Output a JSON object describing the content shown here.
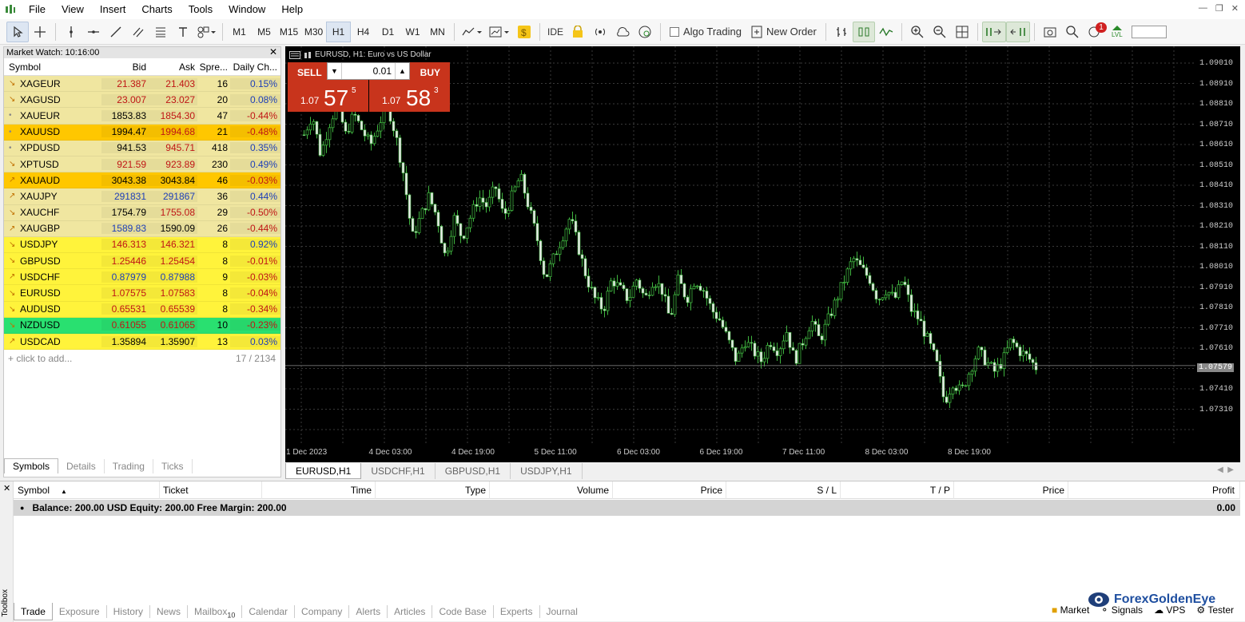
{
  "menu": [
    "File",
    "View",
    "Insert",
    "Charts",
    "Tools",
    "Window",
    "Help"
  ],
  "toolbar": {
    "timeframes": [
      "M1",
      "M5",
      "M15",
      "M30",
      "H1",
      "H4",
      "D1",
      "W1",
      "MN"
    ],
    "active_tf": "H1",
    "ide_label": "IDE",
    "algo_label": "Algo Trading",
    "new_order_label": "New Order",
    "notifications": "1",
    "lvl_label": "LVL"
  },
  "market_watch": {
    "title": "Market Watch: 10:16:00",
    "columns": [
      "Symbol",
      "Bid",
      "Ask",
      "Spre...",
      "Daily Ch..."
    ],
    "rows": [
      {
        "symbol": "XAGEUR",
        "bid": "21.387",
        "ask": "21.403",
        "spread": "16",
        "change": "0.15%",
        "arrow": "down",
        "color": "khaki",
        "bidc": "red",
        "askc": "red",
        "chgc": "blue"
      },
      {
        "symbol": "XAGUSD",
        "bid": "23.007",
        "ask": "23.027",
        "spread": "20",
        "change": "0.08%",
        "arrow": "down",
        "color": "khaki",
        "bidc": "red",
        "askc": "red",
        "chgc": "blue"
      },
      {
        "symbol": "XAUEUR",
        "bid": "1853.83",
        "ask": "1854.30",
        "spread": "47",
        "change": "-0.44%",
        "arrow": "dot",
        "color": "khaki",
        "bidc": "black",
        "askc": "red",
        "chgc": "red"
      },
      {
        "symbol": "XAUUSD",
        "bid": "1994.47",
        "ask": "1994.68",
        "spread": "21",
        "change": "-0.48%",
        "arrow": "dot",
        "color": "orange",
        "bidc": "black",
        "askc": "red",
        "chgc": "red"
      },
      {
        "symbol": "XPDUSD",
        "bid": "941.53",
        "ask": "945.71",
        "spread": "418",
        "change": "0.35%",
        "arrow": "dot",
        "color": "khaki",
        "bidc": "black",
        "askc": "red",
        "chgc": "blue"
      },
      {
        "symbol": "XPTUSD",
        "bid": "921.59",
        "ask": "923.89",
        "spread": "230",
        "change": "0.49%",
        "arrow": "down",
        "color": "khaki",
        "bidc": "red",
        "askc": "red",
        "chgc": "blue"
      },
      {
        "symbol": "XAUAUD",
        "bid": "3043.38",
        "ask": "3043.84",
        "spread": "46",
        "change": "-0.03%",
        "arrow": "up",
        "color": "orange",
        "bidc": "black",
        "askc": "black",
        "chgc": "red"
      },
      {
        "symbol": "XAUJPY",
        "bid": "291831",
        "ask": "291867",
        "spread": "36",
        "change": "0.44%",
        "arrow": "up",
        "color": "khaki",
        "bidc": "blue",
        "askc": "blue",
        "chgc": "blue"
      },
      {
        "symbol": "XAUCHF",
        "bid": "1754.79",
        "ask": "1755.08",
        "spread": "29",
        "change": "-0.50%",
        "arrow": "down",
        "color": "khaki",
        "bidc": "black",
        "askc": "red",
        "chgc": "red"
      },
      {
        "symbol": "XAUGBP",
        "bid": "1589.83",
        "ask": "1590.09",
        "spread": "26",
        "change": "-0.44%",
        "arrow": "up",
        "color": "khaki",
        "bidc": "blue",
        "askc": "black",
        "chgc": "red"
      },
      {
        "symbol": "USDJPY",
        "bid": "146.313",
        "ask": "146.321",
        "spread": "8",
        "change": "0.92%",
        "arrow": "down",
        "color": "yellow",
        "bidc": "red",
        "askc": "red",
        "chgc": "blue"
      },
      {
        "symbol": "GBPUSD",
        "bid": "1.25446",
        "ask": "1.25454",
        "spread": "8",
        "change": "-0.01%",
        "arrow": "down",
        "color": "yellow",
        "bidc": "red",
        "askc": "red",
        "chgc": "red"
      },
      {
        "symbol": "USDCHF",
        "bid": "0.87979",
        "ask": "0.87988",
        "spread": "9",
        "change": "-0.03%",
        "arrow": "up",
        "color": "yellow",
        "bidc": "blue",
        "askc": "blue",
        "chgc": "red"
      },
      {
        "symbol": "EURUSD",
        "bid": "1.07575",
        "ask": "1.07583",
        "spread": "8",
        "change": "-0.04%",
        "arrow": "down",
        "color": "yellow",
        "bidc": "red",
        "askc": "red",
        "chgc": "red"
      },
      {
        "symbol": "AUDUSD",
        "bid": "0.65531",
        "ask": "0.65539",
        "spread": "8",
        "change": "-0.34%",
        "arrow": "down",
        "color": "yellow",
        "bidc": "red",
        "askc": "red",
        "chgc": "red"
      },
      {
        "symbol": "NZDUSD",
        "bid": "0.61055",
        "ask": "0.61065",
        "spread": "10",
        "change": "-0.23%",
        "arrow": "down",
        "color": "green",
        "bidc": "red",
        "askc": "red",
        "chgc": "red"
      },
      {
        "symbol": "USDCAD",
        "bid": "1.35894",
        "ask": "1.35907",
        "spread": "13",
        "change": "0.03%",
        "arrow": "up",
        "color": "yellow",
        "bidc": "black",
        "askc": "black",
        "chgc": "blue"
      }
    ],
    "add_label": "+ click to add...",
    "count": "17 / 2134",
    "tabs": [
      "Symbols",
      "Details",
      "Trading",
      "Ticks"
    ]
  },
  "chart": {
    "title": "EURUSD, H1:  Euro vs US Dollar",
    "sell_label": "SELL",
    "buy_label": "BUY",
    "volume": "0.01",
    "sell_small": "1.07",
    "sell_big": "57",
    "sell_sup": "5",
    "buy_small": "1.07",
    "buy_big": "58",
    "buy_sup": "3",
    "current_price": "1.07579",
    "price_labels": [
      "1.09010",
      "1.08910",
      "1.08810",
      "1.08710",
      "1.08610",
      "1.08510",
      "1.08410",
      "1.08310",
      "1.08210",
      "1.08110",
      "1.08010",
      "1.07910",
      "1.07810",
      "1.07710",
      "1.07610",
      "1.07510",
      "1.07410",
      "1.07310"
    ],
    "time_labels": [
      "1 Dec 2023",
      "4 Dec 03:00",
      "4 Dec 19:00",
      "5 Dec 11:00",
      "6 Dec 03:00",
      "6 Dec 19:00",
      "7 Dec 11:00",
      "8 Dec 03:00",
      "8 Dec 19:00"
    ],
    "tabs": [
      "EURUSD,H1",
      "USDCHF,H1",
      "GBPUSD,H1",
      "USDJPY,H1"
    ]
  },
  "chart_data": {
    "type": "candlestick",
    "symbol": "EURUSD",
    "timeframe": "H1",
    "title": "EURUSD, H1:  Euro vs US Dollar",
    "ylim": [
      1.0721,
      1.0911
    ],
    "x_ticks": [
      "1 Dec 2023",
      "4 Dec 03:00",
      "4 Dec 19:00",
      "5 Dec 11:00",
      "6 Dec 03:00",
      "6 Dec 19:00",
      "7 Dec 11:00",
      "8 Dec 03:00",
      "8 Dec 19:00"
    ],
    "path": [
      1.087,
      1.088,
      1.086,
      1.0875,
      1.0885,
      1.087,
      1.088,
      1.0872,
      1.0865,
      1.0875,
      1.0885,
      1.087,
      1.085,
      1.082,
      1.083,
      1.084,
      1.083,
      1.081,
      1.083,
      1.082,
      1.083,
      1.084,
      1.0835,
      1.0845,
      1.083,
      1.084,
      1.085,
      1.0835,
      1.082,
      1.08,
      1.081,
      1.082,
      1.083,
      1.0815,
      1.08,
      1.079,
      1.0785,
      1.08,
      1.0795,
      1.079,
      1.08,
      1.079,
      1.08,
      1.0795,
      1.078,
      1.08,
      1.079,
      1.08,
      1.0795,
      1.0785,
      1.078,
      1.077,
      1.076,
      1.077,
      1.0765,
      1.076,
      1.077,
      1.0765,
      1.0775,
      1.076,
      1.077,
      1.078,
      1.077,
      1.078,
      1.079,
      1.08,
      1.081,
      1.0805,
      1.08,
      1.079,
      1.0795,
      1.079,
      1.08,
      1.0785,
      1.078,
      1.077,
      1.076,
      1.074,
      1.075,
      1.0745,
      1.0755,
      1.0765,
      1.076,
      1.0755,
      1.076,
      1.077,
      1.0765,
      1.0762,
      1.0757
    ],
    "last": 1.07579
  },
  "trade": {
    "columns": [
      "Symbol",
      "Ticket",
      "Time",
      "Type",
      "Volume",
      "Price",
      "S / L",
      "T / P",
      "Price",
      "Profit"
    ],
    "balance_text": "Balance: 200.00 USD  Equity: 200.00  Free Margin: 200.00",
    "profit": "0.00",
    "tabs": [
      "Trade",
      "Exposure",
      "History",
      "News",
      "Mailbox",
      "Calendar",
      "Company",
      "Alerts",
      "Articles",
      "Code Base",
      "Experts",
      "Journal"
    ],
    "mailbox_count": "10",
    "toolbox_label": "Toolbox"
  },
  "status": [
    "Market",
    "Signals",
    "VPS",
    "Tester"
  ],
  "watermark": "ForexGoldenEye"
}
